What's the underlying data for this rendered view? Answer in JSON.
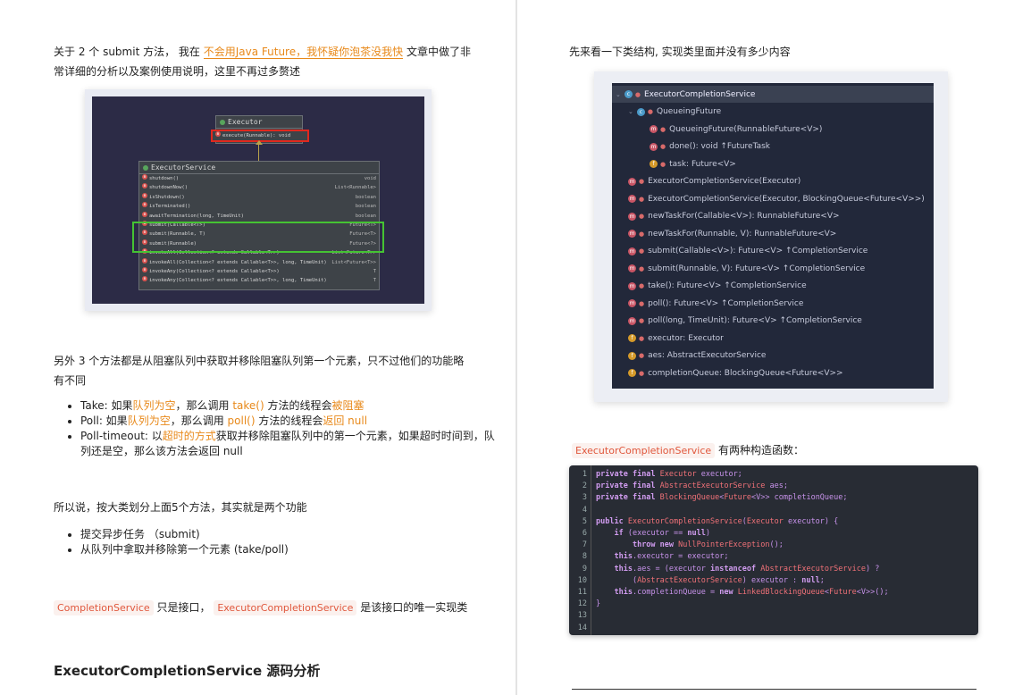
{
  "left": {
    "intro_pre": "关于 2 个 submit 方法， 我在 ",
    "intro_link": "不会用Java Future，我怀疑你泡茶没我快",
    "intro_post": " 文章中做了非常详细的分析以及案例使用说明，这里不再过多赘述",
    "uml": {
      "executor_title": "Executor",
      "executor_method": "execute(Runnable): void",
      "service_title": "ExecutorService",
      "rows": [
        {
          "name": "shutdown()",
          "type": "void"
        },
        {
          "name": "shutdownNow()",
          "type": "List<Runnable>"
        },
        {
          "name": "isShutdown()",
          "type": "boolean"
        },
        {
          "name": "isTerminated()",
          "type": "boolean"
        },
        {
          "name": "awaitTermination(long, TimeUnit)",
          "type": "boolean"
        },
        {
          "name": "submit(Callable<T>)",
          "type": "Future<T>"
        },
        {
          "name": "submit(Runnable, T)",
          "type": "Future<T>"
        },
        {
          "name": "submit(Runnable)",
          "type": "Future<?>"
        },
        {
          "name": "invokeAll(Collection<? extends Callable<T>>)",
          "type": "List<Future<T>>"
        },
        {
          "name": "invokeAll(Collection<? extends Callable<T>>, long, TimeUnit)",
          "type": "List<Future<T>>"
        },
        {
          "name": "invokeAny(Collection<? extends Callable<T>>)",
          "type": "T"
        },
        {
          "name": "invokeAny(Collection<? extends Callable<T>>, long, TimeUnit)",
          "type": "T"
        }
      ]
    },
    "other_methods": "另外 3 个方法都是从阻塞队列中获取并移除阻塞队列第一个元素，只不过他们的功能略有不同",
    "bullets": [
      {
        "a": "Take: 如果",
        "b": "队列为空",
        "c": "，那么调用 ",
        "d": "take()",
        "e": " 方法的线程会",
        "f": "被阻塞",
        "g": ""
      },
      {
        "a": "Poll: 如果",
        "b": "队列为空",
        "c": "，那么调用 ",
        "d": "poll()",
        "e": " 方法的线程会",
        "f": "返回 null",
        "g": ""
      },
      {
        "a": "Poll-timeout: 以",
        "b": "超时的方式",
        "c": "获取并移除阻塞队列中的第一个元素，如果超时时间到，队列还是空，那么该方法会返回 null",
        "d": "",
        "e": "",
        "f": "",
        "g": ""
      }
    ],
    "summary": "所以说，按大类划分上面5个方法，其实就是两个功能",
    "functions": [
      "提交异步任务 （submit)",
      "从队列中拿取并移除第一个元素 (take/poll)"
    ],
    "tag1": "CompletionService",
    "mid1": " 只是接口， ",
    "tag2": "ExecutorCompletionService",
    "mid2": " 是该接口的唯一实现类",
    "section_title": "ExecutorCompletionService 源码分析"
  },
  "right": {
    "intro": "先来看一下类结构, 实现类里面并没有多少内容",
    "tree": [
      {
        "indent": 0,
        "icon": "c",
        "text": "ExecutorCompletionService",
        "sel": true
      },
      {
        "indent": 1,
        "icon": "c",
        "text": "QueueingFuture",
        "sel": false
      },
      {
        "indent": 2,
        "icon": "m",
        "text": "QueueingFuture(RunnableFuture<V>)",
        "sel": false
      },
      {
        "indent": 2,
        "icon": "m",
        "text": "done(): void ↑FutureTask",
        "sel": false
      },
      {
        "indent": 2,
        "icon": "f",
        "text": "task: Future<V>",
        "sel": false
      },
      {
        "indent": 1,
        "icon": "m",
        "text": "ExecutorCompletionService(Executor)",
        "sel": false
      },
      {
        "indent": 1,
        "icon": "m",
        "text": "ExecutorCompletionService(Executor, BlockingQueue<Future<V>>)",
        "sel": false
      },
      {
        "indent": 1,
        "icon": "m",
        "text": "newTaskFor(Callable<V>): RunnableFuture<V>",
        "sel": false
      },
      {
        "indent": 1,
        "icon": "m",
        "text": "newTaskFor(Runnable, V): RunnableFuture<V>",
        "sel": false
      },
      {
        "indent": 1,
        "icon": "m",
        "text": "submit(Callable<V>): Future<V> ↑CompletionService",
        "sel": false
      },
      {
        "indent": 1,
        "icon": "m",
        "text": "submit(Runnable, V): Future<V> ↑CompletionService",
        "sel": false
      },
      {
        "indent": 1,
        "icon": "m",
        "text": "take(): Future<V> ↑CompletionService",
        "sel": false
      },
      {
        "indent": 1,
        "icon": "m",
        "text": "poll(): Future<V> ↑CompletionService",
        "sel": false
      },
      {
        "indent": 1,
        "icon": "m",
        "text": "poll(long, TimeUnit): Future<V> ↑CompletionService",
        "sel": false
      },
      {
        "indent": 1,
        "icon": "f",
        "text": "executor: Executor",
        "sel": false
      },
      {
        "indent": 1,
        "icon": "f",
        "text": "aes: AbstractExecutorService",
        "sel": false
      },
      {
        "indent": 1,
        "icon": "f",
        "text": "completionQueue: BlockingQueue<Future<V>>",
        "sel": false
      }
    ],
    "ctor_tag": "ExecutorCompletionService",
    "ctor_text": " 有两种构造函数：",
    "code": [
      "private final Executor executor;",
      "private final AbstractExecutorService aes;",
      "private final BlockingQueue<Future<V>> completionQueue;",
      "",
      "public ExecutorCompletionService(Executor executor) {",
      "    if (executor == null)",
      "        throw new NullPointerException();",
      "    this.executor = executor;",
      "    this.aes = (executor instanceof AbstractExecutorService) ?",
      "        (AbstractExecutorService) executor : null;",
      "    this.completionQueue = new LinkedBlockingQueue<Future<V>>();",
      "}",
      "",
      ""
    ]
  }
}
